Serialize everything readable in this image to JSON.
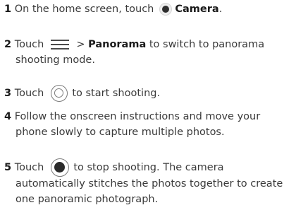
{
  "steps": [
    {
      "num": "1",
      "pre": "On the home screen, touch",
      "bold": "Camera",
      "post": "."
    },
    {
      "num": "2",
      "pre": "Touch",
      "mid": "> ",
      "bold": "Panorama",
      "post": " to switch to panorama",
      "line2": "shooting mode."
    },
    {
      "num": "3",
      "pre": "Touch",
      "post": "to start shooting."
    },
    {
      "num": "4",
      "pre": "Follow the onscreen instructions and move your",
      "line2": "phone slowly to capture multiple photos."
    },
    {
      "num": "5",
      "pre": "Touch",
      "post": "to stop shooting. The camera",
      "line2": "automatically stitches the photos together to create",
      "line3": "one panoramic photograph."
    }
  ],
  "icons": {
    "step1": "camera-app-icon",
    "step2": "menu-icon",
    "step3": "shutter-icon",
    "step5": "stop-icon"
  }
}
